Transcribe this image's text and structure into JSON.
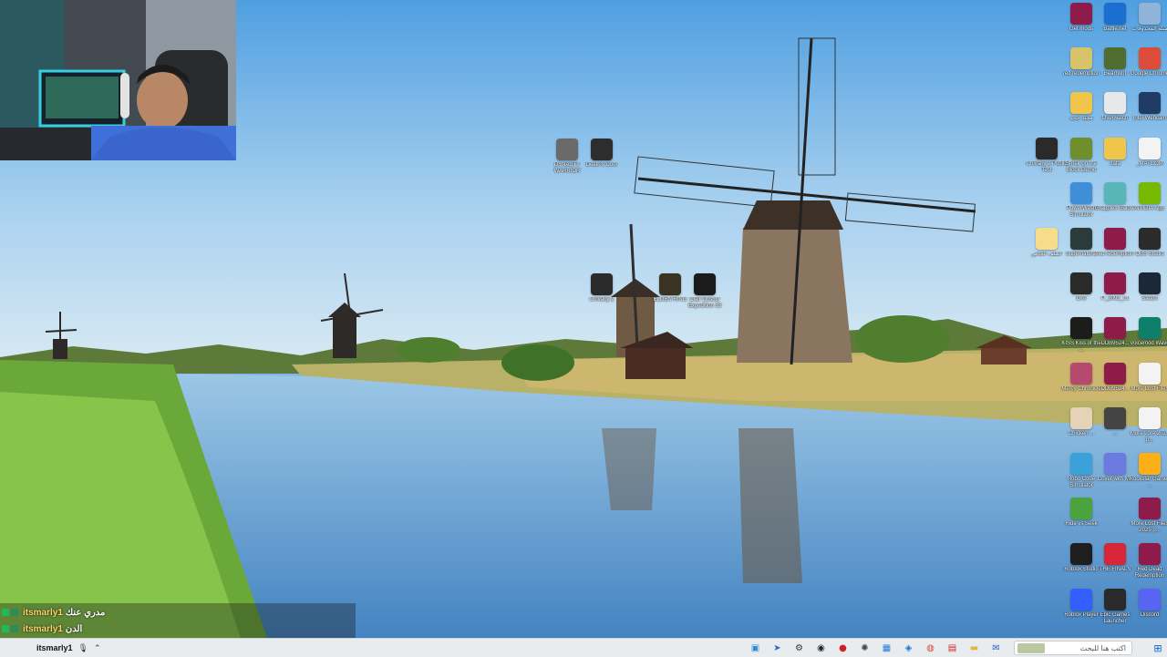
{
  "desktop": {
    "icons": [
      {
        "id": "get-mods",
        "label": "Get mods",
        "icon": "winrar-icon",
        "color": "#8e1b4a"
      },
      {
        "id": "battle-net",
        "label": "Battle.net",
        "icon": "battlenet-icon",
        "color": "#1b6fd1"
      },
      {
        "id": "recycle-bin",
        "label": "سلة المحذوفات",
        "icon": "recycle-bin-icon",
        "color": "#8fb3d9"
      },
      {
        "id": "rdr-redemption",
        "label": "red redemption",
        "icon": "file-icon",
        "color": "#d7c36a"
      },
      {
        "id": "bearhunt",
        "label": "Bearhunt",
        "icon": "goblin-icon",
        "color": "#4f6d2e"
      },
      {
        "id": "google-chrome",
        "label": "Google Chrome",
        "icon": "chrome-icon",
        "color": "#dd4b39"
      },
      {
        "id": "new-folder",
        "label": "مجلد جديد",
        "icon": "folder-icon",
        "color": "#f0c64a"
      },
      {
        "id": "overwatch",
        "label": "Overwatch",
        "icon": "overwatch-icon",
        "color": "#e8e8e8"
      },
      {
        "id": "intel-webcam",
        "label": "Intel Webcam",
        "icon": "webcam-icon",
        "color": "#1f3b66"
      },
      {
        "id": "chivalry-public-test",
        "label": "Chivalry 2 Public Test",
        "icon": "helmet-icon",
        "color": "#2a2a2a"
      },
      {
        "id": "shrek-demo",
        "label": "Shrek on the Block Demo",
        "icon": "shrek-icon",
        "color": "#6e8f2c"
      },
      {
        "id": "data-folder",
        "label": "data",
        "icon": "folder-icon",
        "color": "#f0c64a"
      },
      {
        "id": "matcom",
        "label": "_MATCOM",
        "icon": "document-icon",
        "color": "#f3f3f3"
      },
      {
        "id": "powerwash",
        "label": "PowerWash Simulator",
        "icon": "powerwash-icon",
        "color": "#3f8fd8"
      },
      {
        "id": "grapples-galore",
        "label": "Grapples Galore",
        "icon": "grapple-icon",
        "color": "#58b5b8"
      },
      {
        "id": "nvidia-app",
        "label": "NVIDIA App",
        "icon": "nvidia-icon",
        "color": "#76b900"
      },
      {
        "id": "bootloader",
        "label": "الملف الخاص",
        "icon": "folder-icon",
        "color": "#f5dd8a"
      },
      {
        "id": "supernatural",
        "label": "Supernatural",
        "icon": "supernatural-icon",
        "color": "#2b3a3a"
      },
      {
        "id": "red-redemption-2",
        "label": "red redemption",
        "icon": "winrar-icon",
        "color": "#8e1b4a"
      },
      {
        "id": "obs-studio",
        "label": "OBS Studio",
        "icon": "obs-icon",
        "color": "#2b2b2b"
      },
      {
        "id": "the-dire",
        "label": "Dire",
        "icon": "dire-icon",
        "color": "#2a2a2a"
      },
      {
        "id": "rar-file-1",
        "label": "P_2092_v1",
        "icon": "winrar-icon",
        "color": "#8e1b4a"
      },
      {
        "id": "steam",
        "label": "Steam",
        "icon": "steam-icon",
        "color": "#1b2838"
      },
      {
        "id": "kiss-icon",
        "label": "KISS Kiss of the ...",
        "icon": "kiss-icon",
        "color": "#1c1c1c"
      },
      {
        "id": "rar-file-2",
        "label": "DDB9524...",
        "icon": "winrar-icon",
        "color": "#8e1b4a"
      },
      {
        "id": "soundwave",
        "label": "Voicemod Wave",
        "icon": "soundwave-icon",
        "color": "#0e7f6a"
      },
      {
        "id": "hikaru-icon",
        "label": "Mercy Chronicle",
        "icon": "anime-icon",
        "color": "#b54a6e"
      },
      {
        "id": "rar-file-3",
        "label": "DDB9524...",
        "icon": "winrar-icon",
        "color": "#8e1b4a"
      },
      {
        "id": "more-files",
        "label": "More Lost Files",
        "icon": "document-icon",
        "color": "#f3f3f3"
      },
      {
        "id": "chicken-run",
        "label": "Chicken ...",
        "icon": "chicken-icon",
        "color": "#e6d2b4"
      },
      {
        "id": "epic-unity",
        "label": "...",
        "icon": "unity-icon",
        "color": "#444444"
      },
      {
        "id": "more-lore",
        "label": "More Lore 2025 p...",
        "icon": "document-icon",
        "color": "#f3f3f3"
      },
      {
        "id": "robo-one",
        "label": "Robo Code Simulator",
        "icon": "robot-icon",
        "color": "#3aa2d8"
      },
      {
        "id": "cover-with-me",
        "label": "Cover with Me",
        "icon": "cover-icon",
        "color": "#6c7ae0"
      },
      {
        "id": "rockstar",
        "label": "Rockstar Games ...",
        "icon": "rockstar-icon",
        "color": "#fcaf17"
      },
      {
        "id": "hide-seek",
        "label": "Hide vs Seek",
        "icon": "hideseek-icon",
        "color": "#4ba33e"
      },
      {
        "id": "more-lost-files-2",
        "label": "More Lost Files 2025 p...",
        "icon": "winrar-icon",
        "color": "#8e1b4a"
      },
      {
        "id": "roblox-studio",
        "label": "Roblox Studio",
        "icon": "roblox-studio-icon",
        "color": "#1e1e1e"
      },
      {
        "id": "the-finals",
        "label": "THE FINALS",
        "icon": "finals-icon",
        "color": "#d72638"
      },
      {
        "id": "red-dead-redemption",
        "label": "Red Dead Redemption",
        "icon": "winrar-icon",
        "color": "#8e1b4a"
      },
      {
        "id": "roblox-player",
        "label": "Roblox Player",
        "icon": "roblox-icon",
        "color": "#335fff"
      },
      {
        "id": "epic-games",
        "label": "Epic Games Launcher",
        "icon": "epic-icon",
        "color": "#2a2a2a"
      },
      {
        "id": "discord",
        "label": "Discord",
        "icon": "discord-icon",
        "color": "#5865f2"
      },
      {
        "id": "dynasty-warriors",
        "label": "DYNASTY WARRIOR",
        "icon": "game-icon",
        "color": "#6a6a6a"
      },
      {
        "id": "deaths-door",
        "label": "Death's Door",
        "icon": "door-icon",
        "color": "#2d2d2d"
      },
      {
        "id": "chivalry-2",
        "label": "Chivalry 2",
        "icon": "helmet-icon",
        "color": "#2a2a2a"
      },
      {
        "id": "elden-ring",
        "label": "ELDEN RING",
        "icon": "eldenring-icon",
        "color": "#3a3222"
      },
      {
        "id": "clair-obscur",
        "label": "Clair Obscur Expedition 33",
        "icon": "clair-icon",
        "color": "#1b1b1b"
      }
    ]
  },
  "chat": {
    "lines": [
      {
        "user": "itsmarly1",
        "message": "مدري عنك"
      },
      {
        "user": "itsmarly1",
        "message": "الدن"
      }
    ]
  },
  "taskbar": {
    "left_user": "itsmarly1",
    "search_placeholder": "اكتب هنا للبحث",
    "apps": [
      {
        "name": "edge-icon",
        "glyph": "▣",
        "color": "#2f8bd8"
      },
      {
        "name": "store-icon",
        "glyph": "➤",
        "color": "#1f6fc4"
      },
      {
        "name": "settings-icon",
        "glyph": "⚙",
        "color": "#333333"
      },
      {
        "name": "steam-icon",
        "glyph": "◉",
        "color": "#1b2838"
      },
      {
        "name": "obs-icon",
        "glyph": "●",
        "color": "#cc2222"
      },
      {
        "name": "network-icon",
        "glyph": "✺",
        "color": "#444444"
      },
      {
        "name": "photos-icon",
        "glyph": "▦",
        "color": "#2a7bd6"
      },
      {
        "name": "edge-blue-icon",
        "glyph": "◈",
        "color": "#0f7bd8"
      },
      {
        "name": "chrome-icon",
        "glyph": "◍",
        "color": "#dd4b39"
      },
      {
        "name": "calendar-icon",
        "glyph": "▤",
        "color": "#c62828"
      },
      {
        "name": "file-explorer-icon",
        "glyph": "▬",
        "color": "#e4b73b"
      },
      {
        "name": "mail-icon",
        "glyph": "✉",
        "color": "#2a64c8"
      },
      {
        "name": "task-view-icon",
        "glyph": "▥",
        "color": "#333333"
      }
    ],
    "start_glyph": "⊞"
  }
}
